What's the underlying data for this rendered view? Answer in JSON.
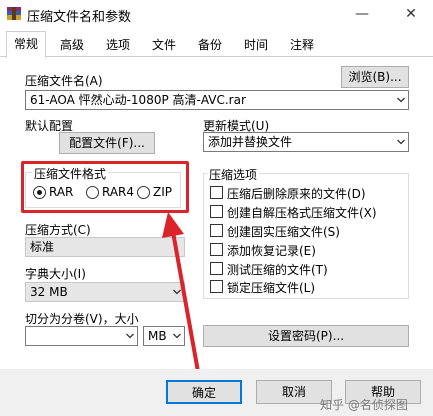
{
  "window": {
    "title": "压缩文件名和参数",
    "minimize_glyph": "—",
    "close_glyph": "✕"
  },
  "tabs": [
    {
      "label": "常规",
      "active": true
    },
    {
      "label": "高级"
    },
    {
      "label": "选项"
    },
    {
      "label": "文件"
    },
    {
      "label": "备份"
    },
    {
      "label": "时间"
    },
    {
      "label": "注释"
    }
  ],
  "archive_name": {
    "label": "压缩文件名(A)",
    "value": "61-AOA 怦然心动-1080P 高清-AVC.rar",
    "browse_button": "浏览(B)..."
  },
  "default_profile": {
    "label": "默认配置",
    "button": "配置文件(F)..."
  },
  "update_mode": {
    "label": "更新模式(U)",
    "value": "添加并替换文件"
  },
  "archive_format": {
    "label": "压缩文件格式",
    "options": [
      {
        "label": "RAR",
        "checked": true
      },
      {
        "label": "RAR4",
        "checked": false
      },
      {
        "label": "ZIP",
        "checked": false
      }
    ]
  },
  "compression_method": {
    "label": "压缩方式(C)",
    "value": "标准"
  },
  "dictionary_size": {
    "label": "字典大小(I)",
    "value": "32 MB"
  },
  "split_volumes": {
    "label": "切分为分卷(V)，大小",
    "value": "",
    "unit": "MB"
  },
  "compression_options": {
    "label": "压缩选项",
    "items": [
      {
        "label": "压缩后删除原来的文件(D)",
        "checked": false
      },
      {
        "label": "创建自解压格式压缩文件(X)",
        "checked": false
      },
      {
        "label": "创建固实压缩文件(S)",
        "checked": false
      },
      {
        "label": "添加恢复记录(E)",
        "checked": false
      },
      {
        "label": "测试压缩的文件(T)",
        "checked": false
      },
      {
        "label": "锁定压缩文件(L)",
        "checked": false
      }
    ]
  },
  "set_password_button": "设置密码(P)...",
  "footer": {
    "ok": "确定",
    "cancel": "取消",
    "help": "帮助"
  },
  "watermark": "知乎 @名侦探图",
  "colors": {
    "highlight_box": "#d9242a",
    "arrow": "#d9242a"
  }
}
